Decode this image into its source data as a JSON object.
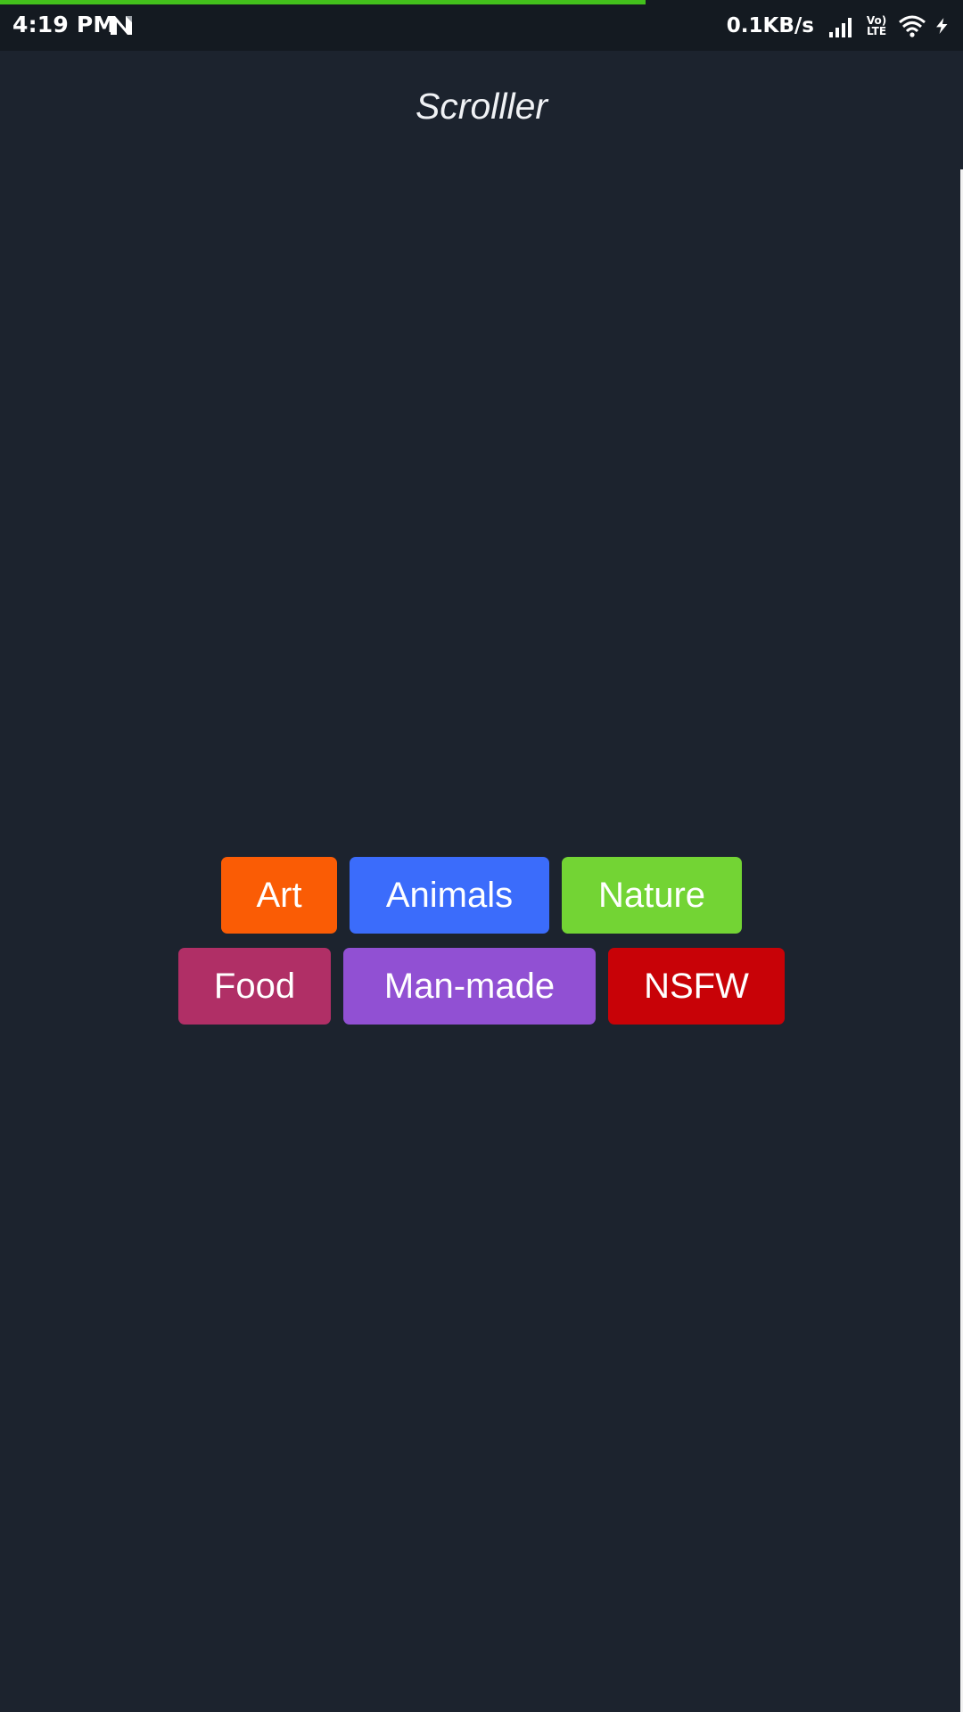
{
  "status_bar": {
    "time": "4:19 PM",
    "net_speed": "0.1KB/s",
    "volte_line1": "Vo)",
    "volte_line2": "LTE",
    "loading_progress": 0.67,
    "progress_color": "#43c01c",
    "icons": [
      "n-notification-icon",
      "signal-icon",
      "volte-icon",
      "wifi-icon",
      "charging-icon"
    ]
  },
  "header": {
    "title": "Scrolller"
  },
  "categories": [
    {
      "label": "Art",
      "color": "#fa5c05"
    },
    {
      "label": "Animals",
      "color": "#3b6cfb"
    },
    {
      "label": "Nature",
      "color": "#73d434"
    },
    {
      "label": "Food",
      "color": "#b02f66"
    },
    {
      "label": "Man-made",
      "color": "#9150d3"
    },
    {
      "label": "NSFW",
      "color": "#c80207"
    }
  ],
  "theme": {
    "background": "#1c232e",
    "status_bar_bg": "#141a21"
  }
}
